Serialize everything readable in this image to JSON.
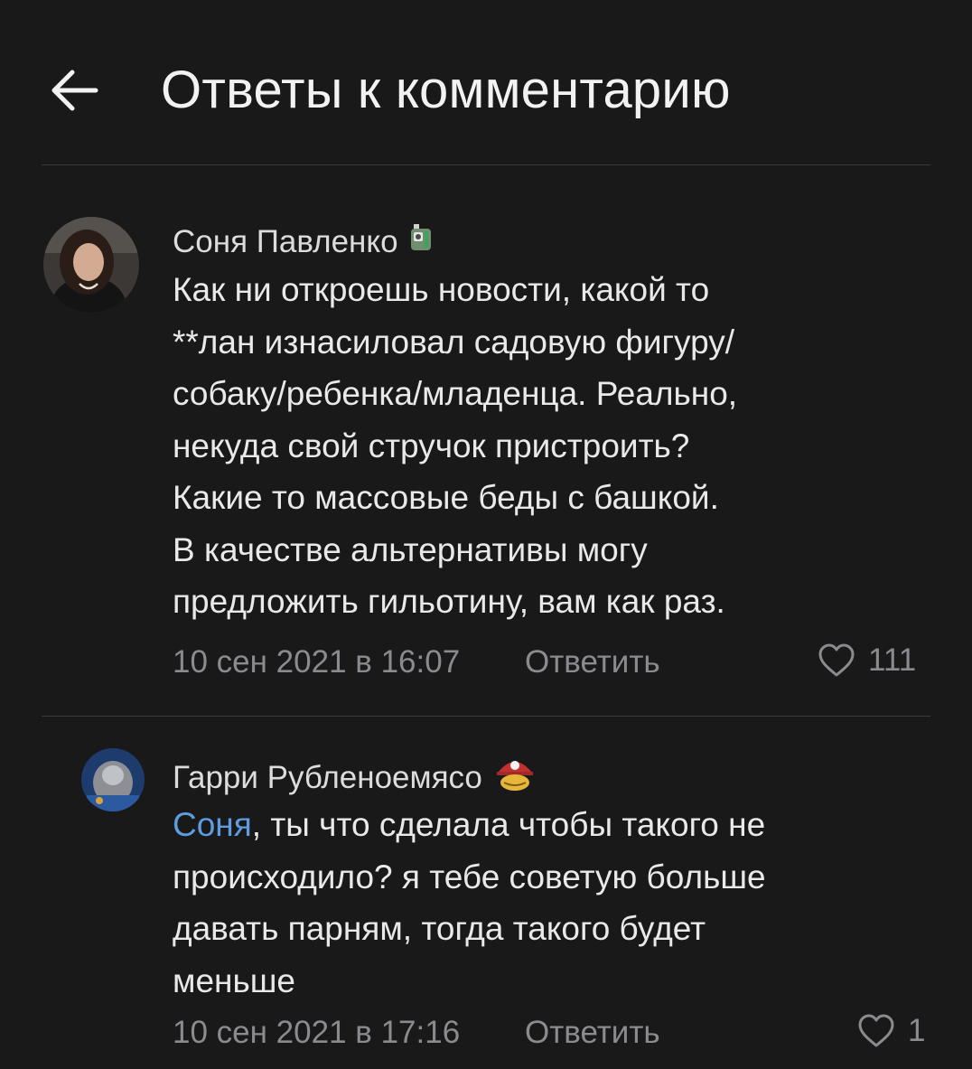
{
  "header": {
    "title": "Ответы к комментарию"
  },
  "comment": {
    "author": "Соня Павленко",
    "lines": [
      "Как ни откроешь новости, какой то",
      "**лан изнасиловал садовую фигуру/",
      "собаку/ребенка/младенца. Реально,",
      "некуда свой стручок пристроить?",
      "Какие то массовые беды с башкой.",
      "В качестве альтернативы могу",
      "предложить гильотину, вам как раз."
    ],
    "date": "10 сен 2021 в 16:07",
    "reply_label": "Ответить",
    "likes": "111"
  },
  "reply": {
    "author": "Гарри Рубленоемясо",
    "mention": "Соня",
    "first_line_rest": ", ты что сделала чтобы такого не",
    "lines": [
      "происходило? я тебе советую больше",
      "давать парням, тогда такого будет",
      "меньше"
    ],
    "date": "10 сен 2021 в 17:16",
    "reply_label": "Ответить",
    "likes": "1"
  },
  "colors": {
    "background": "#19191a",
    "text": "#e9e9e9",
    "muted": "#8b8b8f",
    "mention": "#5d9cde",
    "divider": "#3a3a3c"
  },
  "icons": {
    "back": "arrow-left-icon",
    "like": "heart-outline-icon"
  }
}
